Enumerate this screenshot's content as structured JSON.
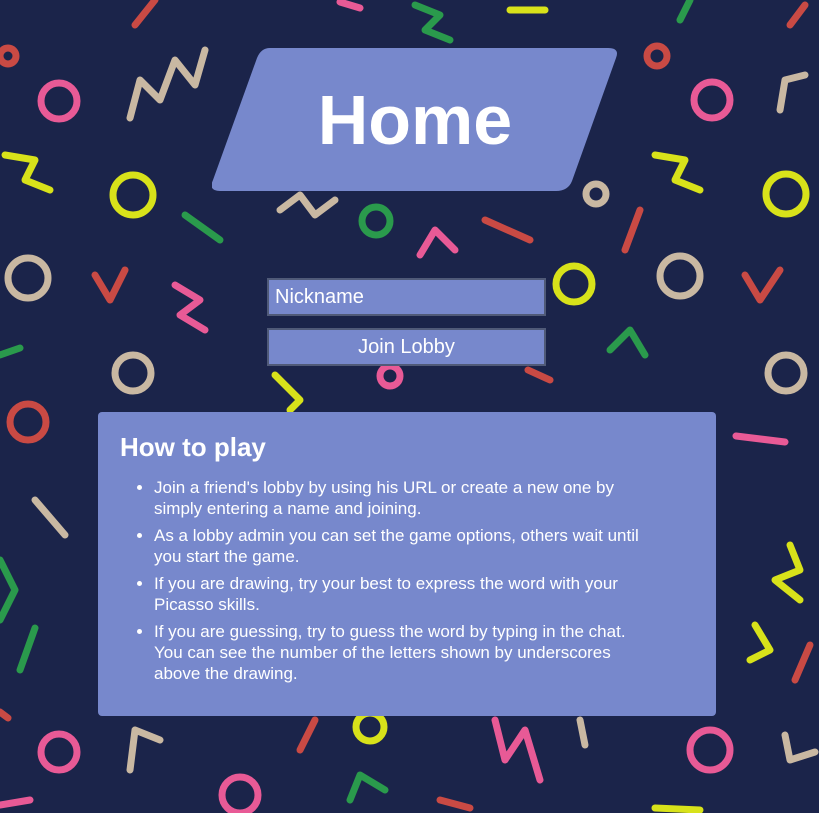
{
  "header": {
    "title": "Home"
  },
  "form": {
    "nickname_placeholder": "Nickname",
    "join_label": "Join Lobby"
  },
  "howto": {
    "title": "How to play",
    "items": [
      "Join a friend's lobby by using his URL or create a new one by simply entering a name and joining.",
      "As a lobby admin you can set the game options, others wait until you start the game.",
      "If you are drawing, try your best to express the word with your Picasso skills.",
      "If you are guessing, try to guess the word by typing in the chat. You can see the number of the letters shown by underscores above the drawing."
    ]
  },
  "colors": {
    "background": "#1b244a",
    "panel": "#7788cc",
    "text": "#ffffff",
    "shape_pink": "#e85a96",
    "shape_yellow": "#d8e21a",
    "shape_green": "#2a9a4c",
    "shape_red": "#c94a44",
    "shape_beige": "#c9b8a2"
  }
}
